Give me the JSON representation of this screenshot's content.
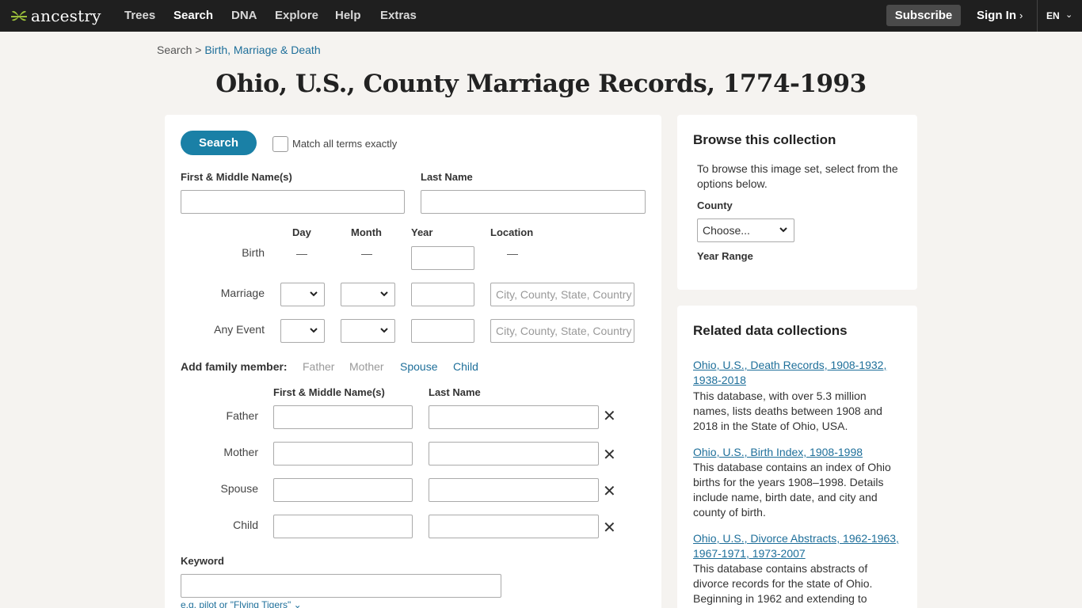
{
  "nav": {
    "logo_text": "ancestry",
    "items": [
      "Trees",
      "Search",
      "DNA",
      "Explore",
      "Help",
      "Extras"
    ],
    "active": "Search",
    "subscribe": "Subscribe",
    "sign_in": "Sign In",
    "language": "EN"
  },
  "breadcrumb": {
    "root": "Search",
    "separator": ">",
    "current": "Birth, Marriage & Death"
  },
  "title": "Ohio, U.S., County Marriage Records, 1774-1993",
  "form": {
    "search_button": "Search",
    "match_exact_label": "Match all terms exactly",
    "first_name_label": "First & Middle Name(s)",
    "last_name_label": "Last Name",
    "col_day": "Day",
    "col_month": "Month",
    "col_year": "Year",
    "col_location": "Location",
    "dash": "—",
    "rows": {
      "birth": "Birth",
      "marriage": "Marriage",
      "any_event": "Any Event"
    },
    "location_placeholder": "City, County, State, Country",
    "family_label": "Add family member:",
    "family_links": {
      "father": "Father",
      "mother": "Mother",
      "spouse": "Spouse",
      "child": "Child"
    },
    "family_first_label": "First & Middle Name(s)",
    "family_last_label": "Last Name",
    "family_rows": {
      "father": "Father",
      "mother": "Mother",
      "spouse": "Spouse",
      "child": "Child"
    },
    "close_glyph": "✕",
    "keyword_label": "Keyword",
    "keyword_hint": "e.g. pilot or \"Flying Tigers\""
  },
  "browse": {
    "title": "Browse this collection",
    "text": "To browse this image set, select from the options below.",
    "county_label": "County",
    "county_select": "Choose...",
    "year_range_label": "Year Range"
  },
  "related": {
    "title": "Related data collections",
    "items": [
      {
        "link": "Ohio, U.S., Death Records, 1908-1932, 1938-2018",
        "desc": "This database, with over 5.3 million names, lists deaths between 1908 and 2018 in the State of Ohio, USA."
      },
      {
        "link": "Ohio, U.S., Birth Index, 1908-1998",
        "desc": "This database contains an index of Ohio births for the years 1908–1998. Details include name, birth date, and city and county of birth."
      },
      {
        "link": "Ohio, U.S., Divorce Abstracts, 1962-1963, 1967-1971, 1973-2007",
        "desc": "This database contains abstracts of divorce records for the state of Ohio. Beginning in 1962 and extending to"
      }
    ]
  },
  "colors": {
    "nav_bg": "#1f1f1f",
    "accent": "#1a80a6",
    "link": "#1e6f9a",
    "page_bg": "#f5f3f0"
  },
  "icons": [
    "ancestry-leaf-logo-icon",
    "chevron-right-icon",
    "chevron-down-icon",
    "close-icon"
  ]
}
